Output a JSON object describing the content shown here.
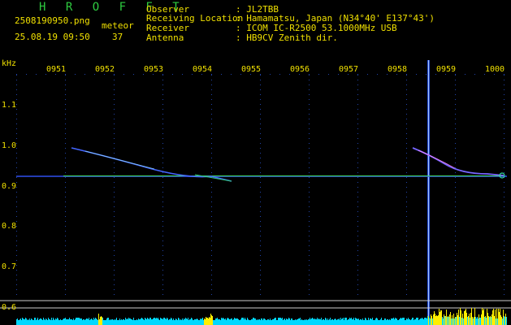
{
  "header": {
    "title": "H R O F F T",
    "filename": "2508190950.png",
    "datetime": "25.08.19 09:50",
    "meteor_label": "meteor",
    "meteor_count": "37"
  },
  "info": {
    "rows": [
      {
        "key": "Observer",
        "value": ": JL2TBB"
      },
      {
        "key": "Receiving Location",
        "value": ": Hamamatsu, Japan (N34°40' E137°43')"
      },
      {
        "key": "Receiver",
        "value": ": ICOM IC-R2500 53.1000MHz USB"
      },
      {
        "key": "Antenna",
        "value": ": HB9CV Zenith dir."
      }
    ]
  },
  "axes": {
    "y_unit": "kHz",
    "y_ticks": [
      "1.1",
      "1.0",
      "0.9",
      "0.8",
      "0.7",
      "0.6"
    ],
    "x_ticks": [
      "0951",
      "0952",
      "0953",
      "0954",
      "0955",
      "0956",
      "0957",
      "0958",
      "0959",
      "1000"
    ]
  },
  "colors": {
    "background": "#000000",
    "text": "#f0e000",
    "title": "#2ecc40",
    "carrier": "#44dd66",
    "echo": "#4466ff",
    "dots": "#2244aa",
    "gridlines": "#cccccc",
    "level_bar": "#00d8ff",
    "level_peak": "#ffee00"
  }
}
